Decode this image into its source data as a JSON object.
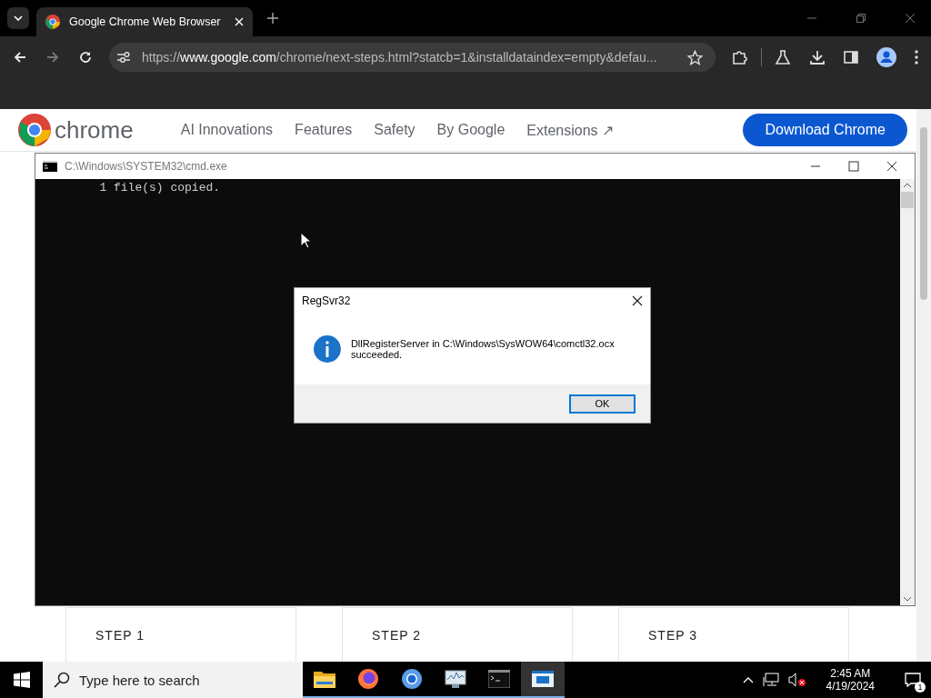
{
  "browser": {
    "tab_title": "Google Chrome Web Browser",
    "url": {
      "scheme": "https://",
      "host": "www.google.com",
      "path": "/chrome/next-steps.html?statcb=1&installdataindex=empty&defau..."
    }
  },
  "page": {
    "logo": "chrome",
    "nav": [
      "AI Innovations",
      "Features",
      "Safety",
      "By Google",
      "Extensions ↗"
    ],
    "cta": "Download Chrome",
    "steps": [
      "STEP 1",
      "STEP 2",
      "STEP 3"
    ]
  },
  "console": {
    "title": "C:\\Windows\\SYSTEM32\\cmd.exe",
    "lines": [
      "        1 file(s) copied."
    ]
  },
  "dialog": {
    "title": "RegSvr32",
    "message": "DllRegisterServer in C:\\Windows\\SysWOW64\\comctl32.ocx succeeded.",
    "button": "OK"
  },
  "taskbar": {
    "search_placeholder": "Type here to search",
    "apps": [
      {
        "kind": "folder",
        "selected": false
      },
      {
        "kind": "firefox",
        "selected": false
      },
      {
        "kind": "chrome",
        "selected": false
      },
      {
        "kind": "monitor",
        "selected": false
      },
      {
        "kind": "terminal",
        "selected": false
      },
      {
        "kind": "dialog",
        "selected": true
      }
    ],
    "time": "2:45 AM",
    "date": "4/19/2024",
    "notifications": "1"
  }
}
